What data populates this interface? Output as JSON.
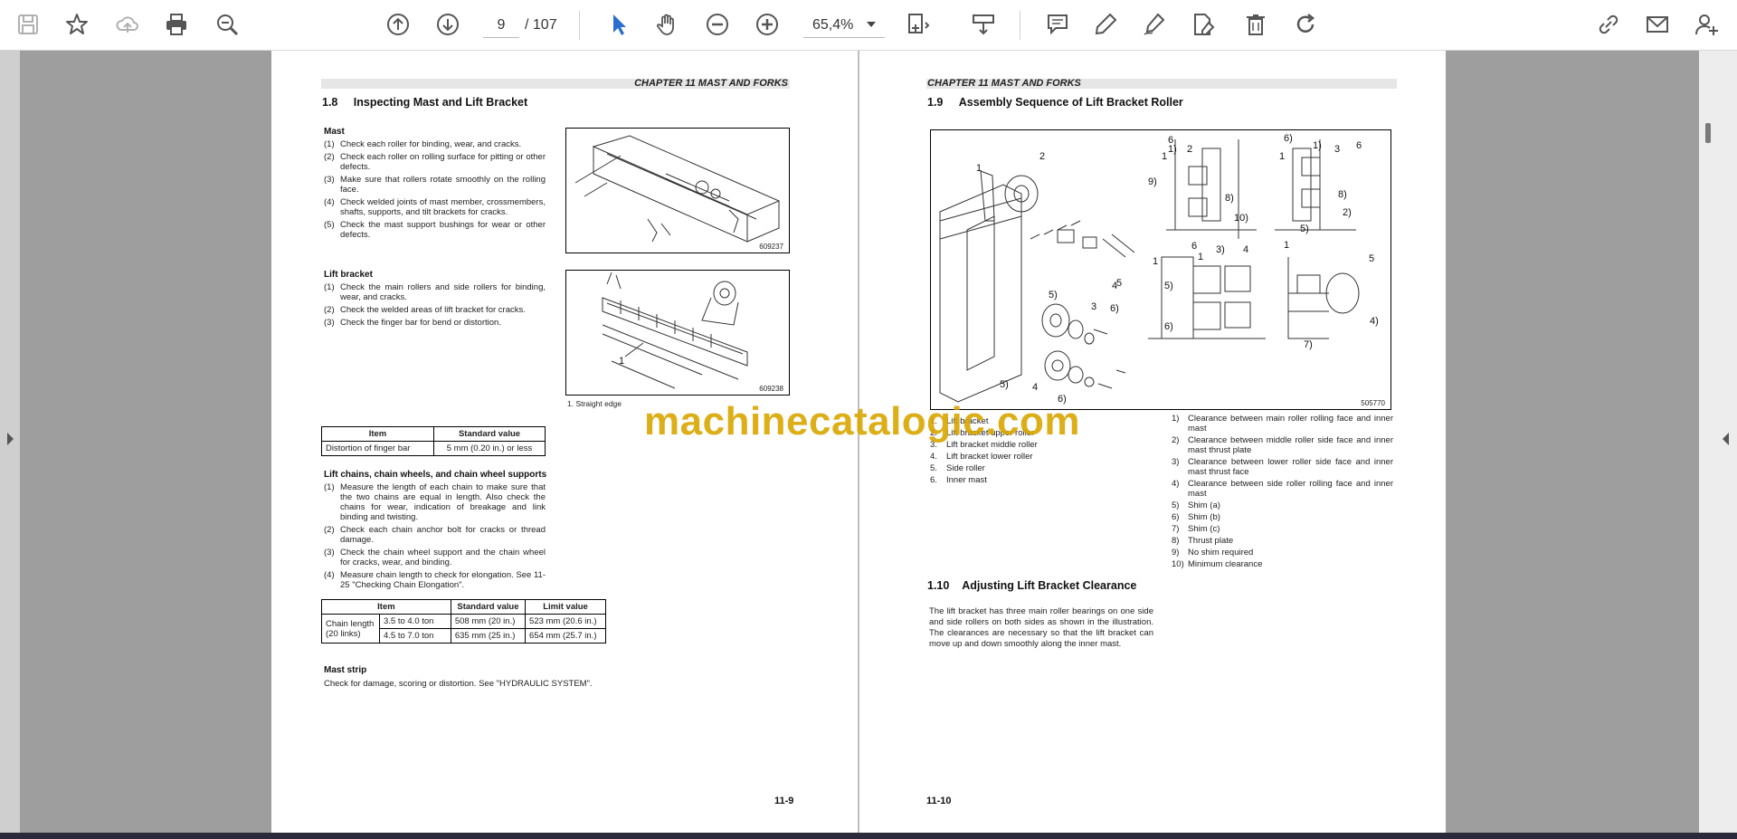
{
  "toolbar": {
    "current_page": "9",
    "total_pages": "/ 107",
    "zoom": "65,4%"
  },
  "left_page": {
    "chapter": "CHAPTER 11 MAST AND FORKS",
    "section": "1.8",
    "section_title": "Inspecting Mast and Lift Bracket",
    "mast_heading": "Mast",
    "mast_items": [
      {
        "n": "(1)",
        "t": "Check each roller for binding, wear, and cracks."
      },
      {
        "n": "(2)",
        "t": "Check each roller on rolling surface for pitting or other defects."
      },
      {
        "n": "(3)",
        "t": "Make sure that rollers rotate smoothly on the rolling face."
      },
      {
        "n": "(4)",
        "t": "Check welded joints of mast member, crossmembers, shafts, supports, and tilt brackets for cracks."
      },
      {
        "n": "(5)",
        "t": "Check the mast support bushings for wear or other defects."
      }
    ],
    "fig1_id": "609237",
    "lift_heading": "Lift bracket",
    "lift_items": [
      {
        "n": "(1)",
        "t": "Check the main rollers and side rollers for binding, wear, and cracks."
      },
      {
        "n": "(2)",
        "t": "Check the welded areas of lift bracket for cracks."
      },
      {
        "n": "(3)",
        "t": "Check the finger bar for bend or distortion."
      }
    ],
    "fig2_id": "609238",
    "fig2_label": "1",
    "fig2_caption": "1. Straight edge",
    "table1": {
      "h_item": "Item",
      "h_std": "Standard value",
      "row_item": "Distortion of finger bar",
      "row_std": "5 mm (0.20 in.) or less"
    },
    "chain_heading": "Lift chains, chain wheels, and chain wheel supports",
    "chain_items": [
      {
        "n": "(1)",
        "t": "Measure the length of each chain to make sure that the two chains are equal in length. Also check the chains for wear, indication of breakage and link binding and twisting."
      },
      {
        "n": "(2)",
        "t": "Check each chain anchor bolt for cracks or thread damage."
      },
      {
        "n": "(3)",
        "t": "Check the chain wheel support and the chain wheel for cracks, wear, and binding."
      },
      {
        "n": "(4)",
        "t": "Measure chain length to check for elongation. See 11-25 \"Checking Chain Elongation\"."
      }
    ],
    "table2": {
      "h_item": "Item",
      "h_std": "Standard value",
      "h_limit": "Limit value",
      "row_label": "Chain length (20 links)",
      "r1_cap": "3.5 to 4.0 ton",
      "r1_std": "508 mm (20 in.)",
      "r1_limit": "523 mm (20.6 in.)",
      "r2_cap": "4.5 to 7.0 ton",
      "r2_std": "635 mm (25 in.)",
      "r2_limit": "654 mm (25.7 in.)"
    },
    "strip_heading": "Mast strip",
    "strip_text": "Check for damage, scoring or distortion. See \"HYDRAULIC SYSTEM\".",
    "page_number": "11-9"
  },
  "right_page": {
    "chapter": "CHAPTER 11 MAST AND FORKS",
    "section": "1.9",
    "section_title": "Assembly Sequence of Lift Bracket Roller",
    "fig_id": "505770",
    "parts_list": [
      {
        "n": "1.",
        "t": "Lift bracket"
      },
      {
        "n": "2.",
        "t": "Lift bracket upper roller"
      },
      {
        "n": "3.",
        "t": "Lift bracket middle roller"
      },
      {
        "n": "4.",
        "t": "Lift bracket lower roller"
      },
      {
        "n": "5.",
        "t": "Side roller"
      },
      {
        "n": "6.",
        "t": "Inner mast"
      }
    ],
    "clearance_list": [
      {
        "n": "1)",
        "t": "Clearance between main roller rolling face and inner mast"
      },
      {
        "n": "2)",
        "t": "Clearance between middle roller side face and inner mast thrust plate"
      },
      {
        "n": "3)",
        "t": "Clearance between lower roller side face and inner mast thrust face"
      },
      {
        "n": "4)",
        "t": "Clearance between side roller rolling face and inner mast"
      },
      {
        "n": "5)",
        "t": "Shim (a)"
      },
      {
        "n": "6)",
        "t": "Shim (b)"
      },
      {
        "n": "7)",
        "t": "Shim (c)"
      },
      {
        "n": "8)",
        "t": "Thrust plate"
      },
      {
        "n": "9)",
        "t": "No shim required"
      },
      {
        "n": "10)",
        "t": "Minimum clearance"
      }
    ],
    "section2": "1.10",
    "section2_title": "Adjusting Lift Bracket Clearance",
    "section2_text": "The lift bracket has three main roller bearings on one side and side rollers on both sides as shown in the illustration. The clearances are necessary so that the lift bracket can move up and down smoothly along the inner mast.",
    "page_number": "11-10"
  },
  "watermark": "machinecatalogic.com"
}
